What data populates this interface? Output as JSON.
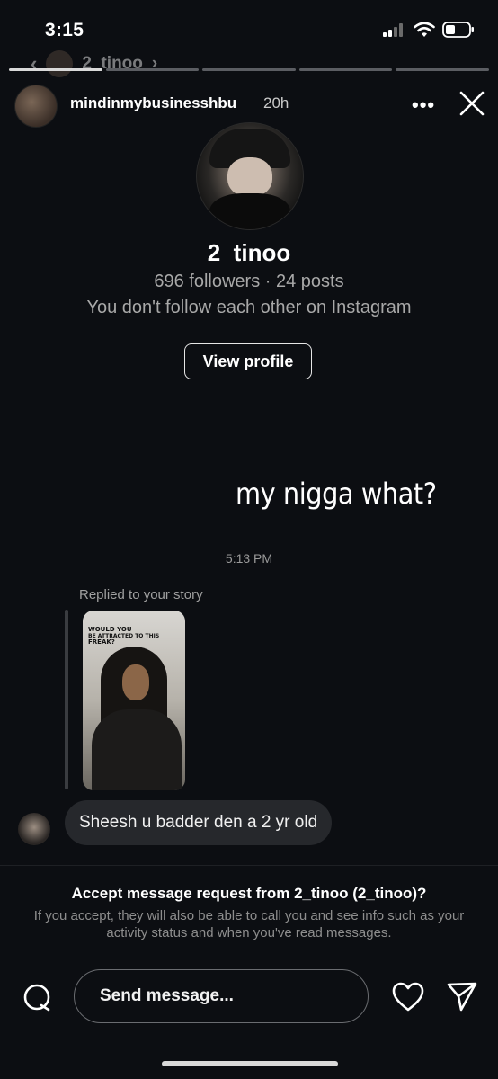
{
  "status_bar": {
    "time": "3:15"
  },
  "ghost_header": {
    "username": "2_tinoo",
    "chevron": "›"
  },
  "story": {
    "username": "mindinmybusinesshbu",
    "time": "20h",
    "more_icon": "•••",
    "text": "my nigga what?"
  },
  "profile": {
    "username": "2_tinoo",
    "stats": "696 followers · 24 posts",
    "follow_status": "You don't follow each other on Instagram",
    "view_profile_label": "View profile"
  },
  "conversation": {
    "timestamp": "5:13 PM",
    "replied_label": "Replied to your story",
    "story_thumb_caption_line1": "WOULD YOU",
    "story_thumb_caption_line2": "BE ATTRACTED TO THIS",
    "story_thumb_caption_line3": "FREAK?",
    "message": "Sheesh u badder den a 2 yr old"
  },
  "request": {
    "title": "Accept message request from 2_tinoo (2_tinoo)?",
    "description": "If you accept, they will also be able to call you and see info such as your activity status and when you've read messages."
  },
  "composer": {
    "placeholder": "Send message..."
  },
  "icons": {
    "camera": "camera-icon",
    "heart": "heart-icon",
    "send": "send-icon",
    "close": "close-icon",
    "more": "more-icon"
  },
  "colors": {
    "background": "#0c0e12",
    "bubble": "#26282c",
    "muted_text": "#a8a8a8"
  }
}
